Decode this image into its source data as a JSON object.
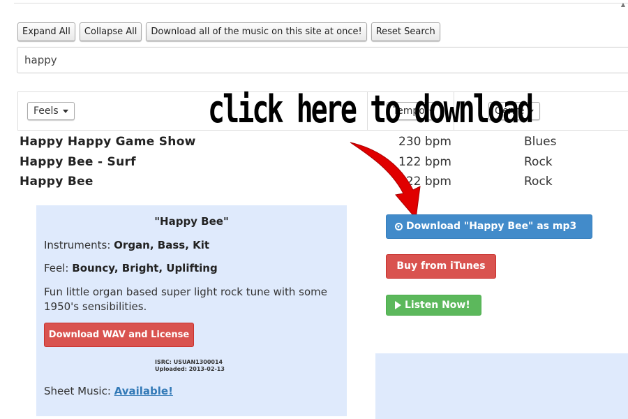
{
  "toolbar": {
    "expand_all": "Expand All",
    "collapse_all": "Collapse All",
    "download_all": "Download all of the music on this site at once!",
    "reset_search": "Reset Search"
  },
  "search": {
    "value": "happy"
  },
  "filters": {
    "feels": "Feels",
    "tempo": "Tempo",
    "genre": "Genre"
  },
  "annotation": "click here to download",
  "tracks": [
    {
      "title": "Happy Happy Game Show",
      "bpm": "230 bpm",
      "genre": "Blues"
    },
    {
      "title": "Happy Bee - Surf",
      "bpm": "122 bpm",
      "genre": "Rock"
    },
    {
      "title": "Happy Bee",
      "bpm": "122 bpm",
      "genre": "Rock"
    }
  ],
  "detail": {
    "title": "\"Happy Bee\"",
    "instruments_label": "Instruments: ",
    "instruments": "Organ, Bass, Kit",
    "feel_label": "Feel: ",
    "feel": "Bouncy, Bright, Uplifting",
    "description": "Fun little organ based super light rock tune with some 1950's sensibilities.",
    "download_wav": "Download WAV and License",
    "isrc": "ISRC: USUAN1300014",
    "uploaded": "Uploaded: 2013-02-13",
    "sheet_music_label": "Sheet Music: ",
    "sheet_music_link": "Available!"
  },
  "actions": {
    "download_mp3": "Download \"Happy Bee\" as mp3",
    "buy_itunes": "Buy from iTunes",
    "listen_now": "Listen Now!"
  },
  "colors": {
    "primary": "#428bca",
    "danger": "#d9534f",
    "success": "#5cb85c",
    "panel": "#dfeafc",
    "arrow": "#e00000"
  }
}
